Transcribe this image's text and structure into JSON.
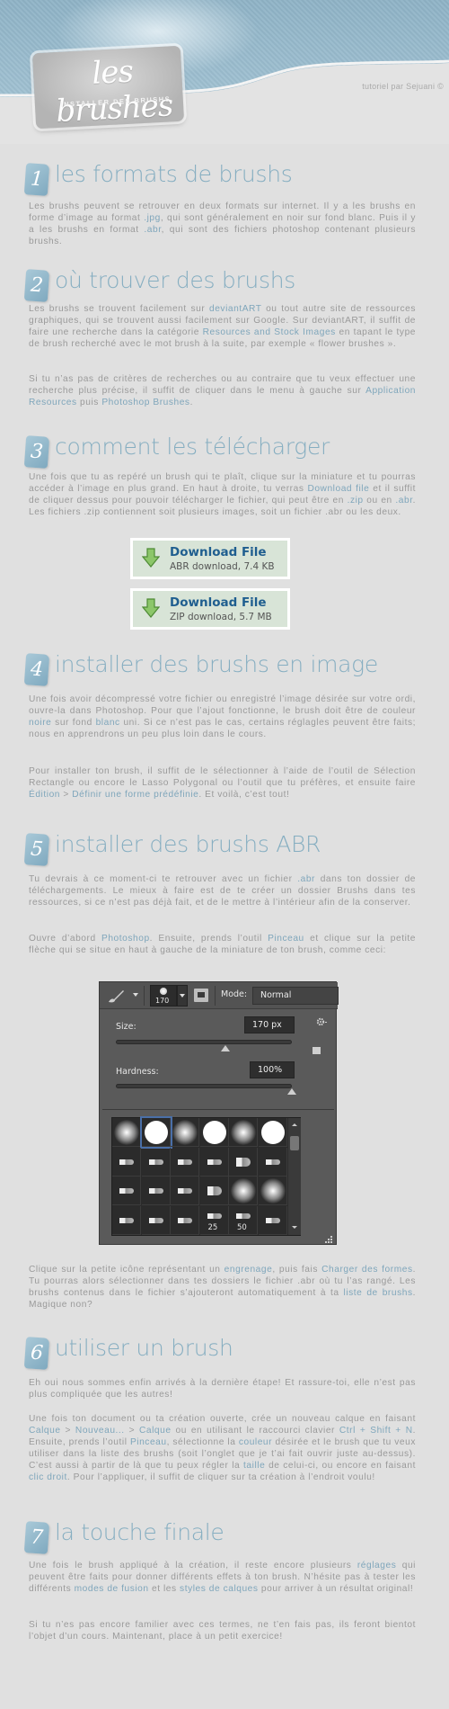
{
  "header": {
    "logo_script": "les brushes",
    "logo_subtitle": "INSTALLER DES BRUSHS",
    "credit": "tutoriel par Sejuani ©"
  },
  "colors": {
    "accent": "#86aec1",
    "link": "#7fa6bb",
    "text": "#9a9a9a",
    "background": "#e0e0e0",
    "download_title": "#1f5e8f",
    "download_bg": "#d8e4d7"
  },
  "sections": [
    {
      "number": "1",
      "title": "les formats de brushs",
      "paragraphs": [
        [
          {
            "t": "Les brushs peuvent se retrouver en deux formats sur internet. Il y a les brushs en forme d’image au format "
          },
          {
            "t": ".jpg",
            "hl": true
          },
          {
            "t": ", qui sont généralement en noir sur fond blanc. Puis il y a les brushs en format "
          },
          {
            "t": ".abr",
            "hl": true
          },
          {
            "t": ", qui sont des fichiers photoshop contenant plusieurs brushs."
          }
        ]
      ]
    },
    {
      "number": "2",
      "title": "où trouver des brushs",
      "paragraphs": [
        [
          {
            "t": "Les brushs se trouvent facilement sur "
          },
          {
            "t": "deviantART",
            "hl": true
          },
          {
            "t": " ou tout autre site de ressources graphiques, qui se trouvent aussi facilement sur Google. Sur deviantART, il suffit de faire une recherche dans la catégorie "
          },
          {
            "t": "Resources and Stock Images",
            "hl": true
          },
          {
            "t": " en tapant le type de brush recherché avec le mot brush à la suite, par exemple « flower brushes »."
          }
        ],
        [
          {
            "t": "Si tu n’as pas de critères de recherches ou au contraire que tu veux effectuer une recherche plus précise, il suffit de cliquer dans le menu à gauche sur "
          },
          {
            "t": "Application Resources",
            "hl": true
          },
          {
            "t": " puis "
          },
          {
            "t": "Photoshop Brushes",
            "hl": true
          },
          {
            "t": "."
          }
        ]
      ]
    },
    {
      "number": "3",
      "title": "comment les télécharger",
      "paragraphs": [
        [
          {
            "t": "Une fois que tu as repéré un brush qui te plaît, clique sur la miniature et tu pourras accéder à l’image en plus grand. En haut à droite, tu verras "
          },
          {
            "t": "Download file",
            "hl": true
          },
          {
            "t": " et il suffit de cliquer dessus pour pouvoir télécharger le fichier, qui peut être en "
          },
          {
            "t": ".zip",
            "hl": true
          },
          {
            "t": " ou en "
          },
          {
            "t": ".abr",
            "hl": true
          },
          {
            "t": ". Les fichiers .zip contiennent soit plusieurs images, soit un fichier .abr ou les deux."
          }
        ]
      ],
      "downloads": [
        {
          "title": "Download File",
          "subtitle": "ABR download, 7.4 KB",
          "icon": "green-down-arrow-icon"
        },
        {
          "title": "Download File",
          "subtitle": "ZIP download, 5.7 MB",
          "icon": "green-down-arrow-icon"
        }
      ]
    },
    {
      "number": "4",
      "title": "installer des brushs en image",
      "paragraphs": [
        [
          {
            "t": "Une fois avoir décompressé votre fichier ou enregistré l’image désirée sur votre ordi, ouvre-la dans Photoshop. Pour que l’ajout fonctionne, le brush doit être de couleur "
          },
          {
            "t": "noire",
            "hl": true
          },
          {
            "t": " sur fond "
          },
          {
            "t": "blanc",
            "hl": true
          },
          {
            "t": " uni. Si ce n’est pas le cas, certains réglagles peuvent être faits; nous en apprendrons un peu plus loin dans le cours."
          }
        ],
        [
          {
            "t": "Pour installer ton brush, il suffit de le sélectionner à l’aide de l’outil de Sélection Rectangle ou encore le Lasso Polygonal ou l’outil que tu préfères, et ensuite faire "
          },
          {
            "t": "Édition",
            "hl": true
          },
          {
            "t": " > "
          },
          {
            "t": "Définir une forme prédéfinie",
            "hl": true
          },
          {
            "t": ". Et voilà, c’est tout!"
          }
        ]
      ]
    },
    {
      "number": "5",
      "title": "installer des brushs ABR",
      "paragraphs": [
        [
          {
            "t": "Tu devrais à ce moment-ci te retrouver avec un fichier "
          },
          {
            "t": ".abr",
            "hl": true
          },
          {
            "t": " dans ton dossier de téléchargements. Le mieux à faire est de te créer un dossier Brushs dans tes ressources, si ce n’est pas déjà fait, et de le mettre à l’intérieur afin de la conserver."
          }
        ],
        [
          {
            "t": "Ouvre d’abord "
          },
          {
            "t": "Photoshop",
            "hl": true
          },
          {
            "t": ". Ensuite, prends l’outil "
          },
          {
            "t": "Pinceau",
            "hl": true
          },
          {
            "t": " et clique sur la petite flèche qui se situe en haut à gauche de la miniature de ton brush, comme ceci:"
          }
        ],
        [
          {
            "t": "Clique sur la petite icône représentant un "
          },
          {
            "t": "engrenage",
            "hl": true
          },
          {
            "t": ", puis fais "
          },
          {
            "t": "Charger des formes",
            "hl": true
          },
          {
            "t": ". Tu pourras alors sélectionner dans tes dossiers le fichier .abr où tu l’as rangé. Les brushs contenus dans le fichier s’ajouteront automatiquement à ta "
          },
          {
            "t": "liste de brushs",
            "hl": true
          },
          {
            "t": ". Magique non?"
          }
        ]
      ],
      "photoshop_panel": {
        "brush_size_preview": "170",
        "mode_label": "Mode:",
        "mode_value": "Normal",
        "size_label": "Size:",
        "size_value": "170 px",
        "size_slider_fraction": 0.62,
        "hardness_label": "Hardness:",
        "hardness_value": "100%",
        "hardness_slider_fraction": 1.0,
        "brush_grid_labels": [
          "25",
          "50"
        ]
      }
    },
    {
      "number": "6",
      "title": "utiliser un brush",
      "paragraphs": [
        [
          {
            "t": "Eh oui nous sommes enfin arrivés à la dernière étape! Et rassure-toi, elle n’est pas plus compliquée que les autres!"
          }
        ],
        [
          {
            "t": "Une fois ton document ou ta création ouverte, crée un nouveau calque en faisant "
          },
          {
            "t": "Calque",
            "hl": true
          },
          {
            "t": " > "
          },
          {
            "t": "Nouveau...",
            "hl": true
          },
          {
            "t": " > "
          },
          {
            "t": "Calque",
            "hl": true
          },
          {
            "t": " ou en utilisant le raccourci clavier "
          },
          {
            "t": "Ctrl + Shift + N",
            "hl": true
          },
          {
            "t": ". Ensuite, prends l’outil "
          },
          {
            "t": "Pinceau",
            "hl": true
          },
          {
            "t": ", sélectionne la "
          },
          {
            "t": "couleur",
            "hl": true
          },
          {
            "t": " désirée et le brush que tu veux utiliser dans la liste des brushs (soit l’onglet que je t’ai fait ouvrir juste au-dessus). C’est aussi à partir de là que tu peux régler la "
          },
          {
            "t": "taille",
            "hl": true
          },
          {
            "t": " de celui-ci, ou encore en faisant "
          },
          {
            "t": "clic droit",
            "hl": true
          },
          {
            "t": ". Pour l’appliquer, il suffit de cliquer sur ta création à l’endroit voulu!"
          }
        ]
      ]
    },
    {
      "number": "7",
      "title": "la touche finale",
      "paragraphs": [
        [
          {
            "t": "Une fois le brush appliqué à la création, il reste encore plusieurs "
          },
          {
            "t": "réglages",
            "hl": true
          },
          {
            "t": " qui peuvent être faits pour donner différents effets à ton brush. N’hésite pas à tester les différents "
          },
          {
            "t": "modes de fusion",
            "hl": true
          },
          {
            "t": " et les "
          },
          {
            "t": "styles de calques",
            "hl": true
          },
          {
            "t": " pour arriver à un résultat original!"
          }
        ],
        [
          {
            "t": "Si tu n’es pas encore familier avec ces termes, ne t’en fais pas, ils feront bientot l’objet d’un cours. Maintenant, place à un petit exercice!"
          }
        ]
      ]
    }
  ]
}
